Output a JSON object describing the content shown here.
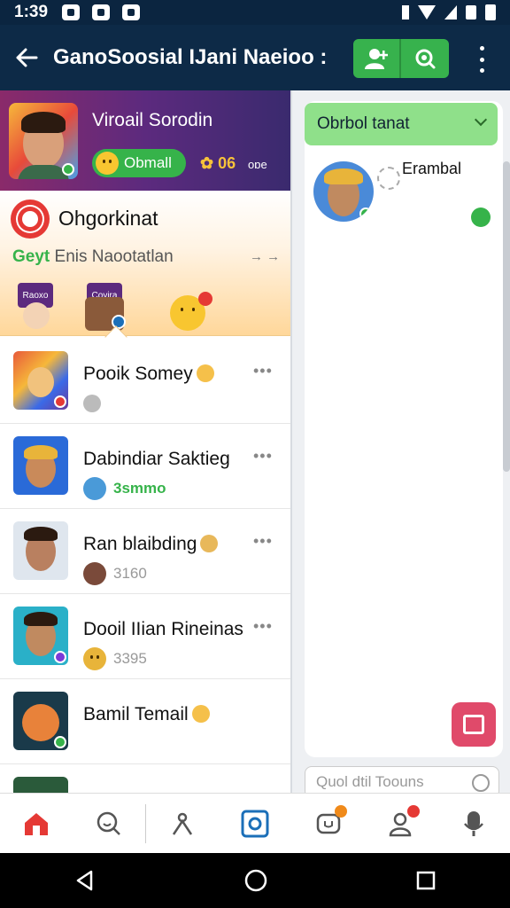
{
  "status": {
    "time": "1:39"
  },
  "appbar": {
    "title": "GanoSoosial IJani Naeioo :"
  },
  "profile": {
    "name": "Viroail Sorodin",
    "pill_label": "Obmall",
    "count": "06",
    "extra": "oɒe"
  },
  "org": {
    "title": "Ohgorkinat",
    "subtitle_accent": "Geyt",
    "subtitle": "Enis Naootatlan",
    "arrow": "→ →",
    "mini_label_1": "Raoxo",
    "mini_label_2": "Covira"
  },
  "chats": [
    {
      "name": "Pooik Somey",
      "sub": ""
    },
    {
      "name": "Dabindiar Saktieg",
      "sub": "3smmo"
    },
    {
      "name": "Ran blaibding",
      "sub": "3160"
    },
    {
      "name": "Dooil IIian Rineinas",
      "sub": "3395"
    },
    {
      "name": "Bamil Temail",
      "sub": ""
    }
  ],
  "chat_more": "•••",
  "right": {
    "select_label": "Obrbol tanat",
    "contact_name": "Erambal",
    "input_placeholder": "Quol dtil Toouns"
  },
  "colors": {
    "primary": "#0d2a47",
    "accent_green": "#36b34a",
    "fab_pink": "#e04a6a",
    "active_nav": "#1b6fb8"
  },
  "nav": [
    "home-icon",
    "search-icon",
    "tools-icon",
    "camera-icon",
    "chat-icon",
    "people-icon",
    "mic-icon"
  ]
}
